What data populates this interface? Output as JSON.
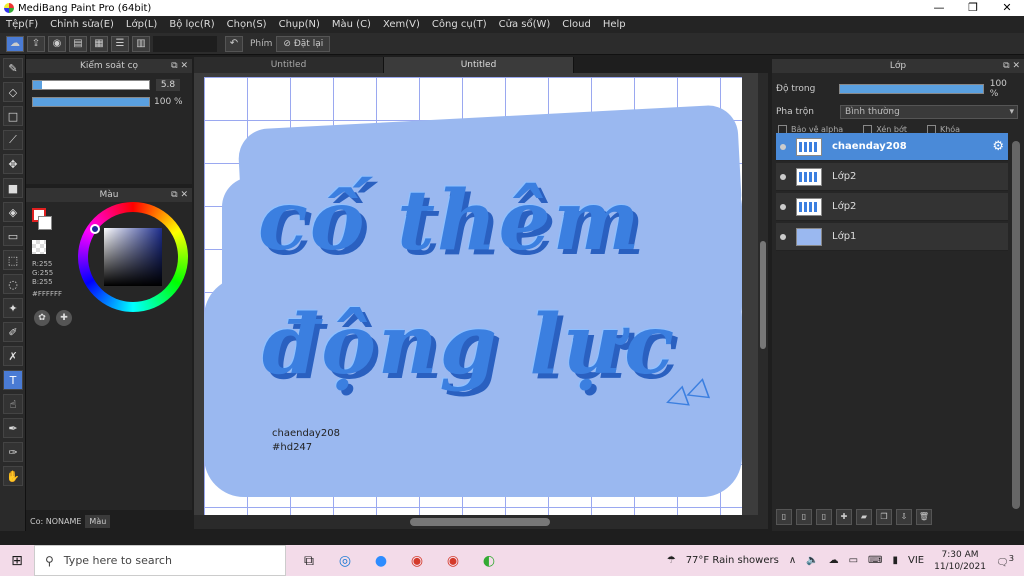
{
  "window": {
    "title": "MediBang Paint Pro (64bit)"
  },
  "menu": [
    "Tệp(F)",
    "Chỉnh sửa(E)",
    "Lớp(L)",
    "Bộ lọc(R)",
    "Chọn(S)",
    "Chụp(N)",
    "Màu (C)",
    "Xem(V)",
    "Công cụ(T)",
    "Cửa sổ(W)",
    "Cloud",
    "Help"
  ],
  "toolbar": {
    "phim_label": "Phím",
    "redo_label": "Đặt lại"
  },
  "brush_panel": {
    "title": "Kiểm soát cọ",
    "size_value": "5.8",
    "size_fill": 0.08,
    "opacity_value": "100 %",
    "opacity_fill": 1.0
  },
  "color_panel": {
    "title": "Màu",
    "r": "R:255",
    "g": "G:255",
    "b": "B:255",
    "hex": "#FFFFFF"
  },
  "bottom_tabs": {
    "brush": "Co: NONAME",
    "color": "Màu"
  },
  "doc_tabs": [
    "Untitled",
    "Untitled"
  ],
  "canvas": {
    "line1": "cố thêm",
    "line2": "động lực",
    "signature_name": "chaenday208",
    "signature_tag": "#hd247"
  },
  "layer_panel": {
    "title": "Lớp",
    "opacity_label": "Độ trong",
    "opacity_value": "100 %",
    "blend_label": "Pha trộn",
    "blend_value": "Bình thường",
    "protect_alpha": "Bảo vệ alpha",
    "clip": "Xén bớt",
    "lock": "Khóa",
    "layers": [
      {
        "name": "chaenday208",
        "selected": true
      },
      {
        "name": "Lớp2",
        "selected": false
      },
      {
        "name": "Lớp2",
        "selected": false
      },
      {
        "name": "Lớp1",
        "selected": false
      }
    ]
  },
  "taskbar": {
    "search_placeholder": "Type here to search",
    "weather": "77°F  Rain showers",
    "lang": "VIE",
    "time": "7:30 AM",
    "date": "11/10/2021",
    "notifications": "3"
  }
}
